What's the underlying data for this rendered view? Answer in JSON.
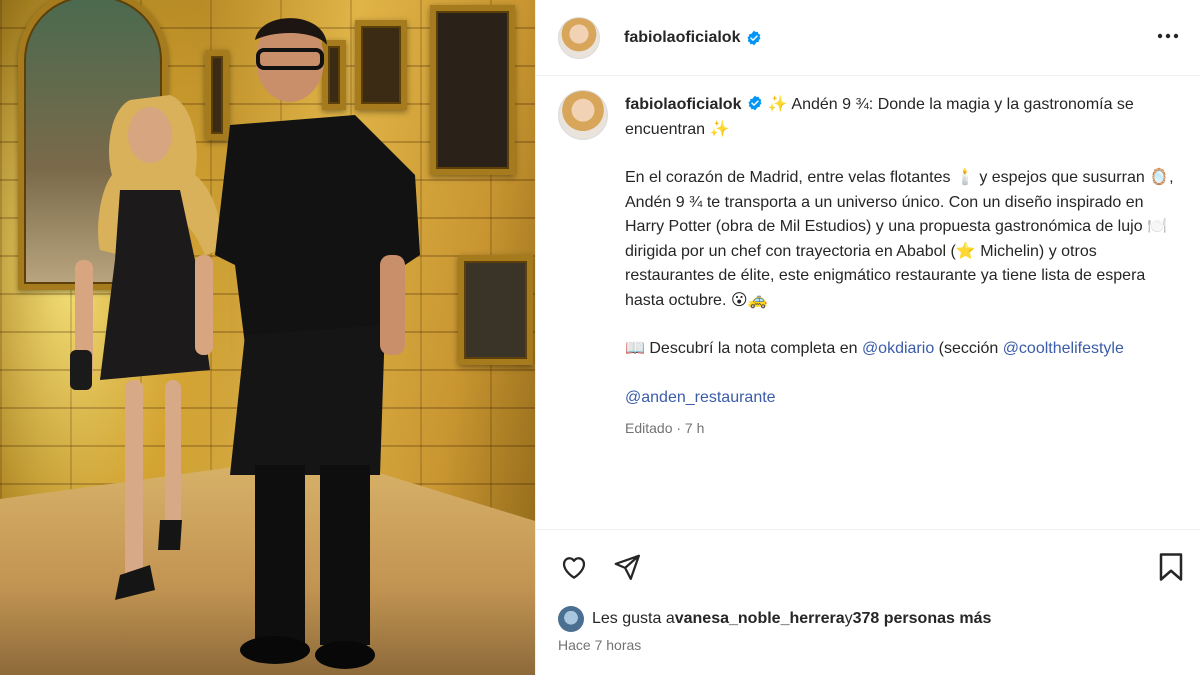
{
  "post": {
    "username": "fabiolaoficialok",
    "caption": {
      "line1": " ✨ Andén 9 ¾: Donde la magia y la gastronomía se encuentran ✨",
      "para2_a": "En el corazón de Madrid, entre velas flotantes 🕯️ y espejos que susurran 🪞, Andén 9 ¾ te transporta a un universo único. Con un diseño inspirado en Harry Potter (obra de Mil Estudios) y una propuesta gastronómica de lujo 🍽️ dirigida por un chef con trayectoria en Ababol (⭐ Michelin) y otros restaurantes de élite, este enigmático restaurante ya tiene lista de espera hasta octubre. 😮🚕",
      "para3_prefix": "📖 Descubrí la nota completa en ",
      "mention1": "@okdiario",
      "para3_middle": " (sección ",
      "mention2": "@coolthelifestyle",
      "mention3": "@anden_restaurante"
    },
    "edited_meta": "Editado · 7 h",
    "likes": {
      "prefix": "Les gusta a ",
      "user": "vanesa_noble_herrera",
      "middle": " y ",
      "count": "378 personas más"
    },
    "time_ago": "Hace 7 horas"
  },
  "icons": {
    "header": [
      "verified-badge-icon",
      "more-options-icon"
    ],
    "actions": [
      "heart-icon",
      "share-icon",
      "bookmark-icon"
    ]
  },
  "colors": {
    "mention": "#3b5ca8",
    "verified": "#0095f6",
    "meta": "#737373"
  }
}
